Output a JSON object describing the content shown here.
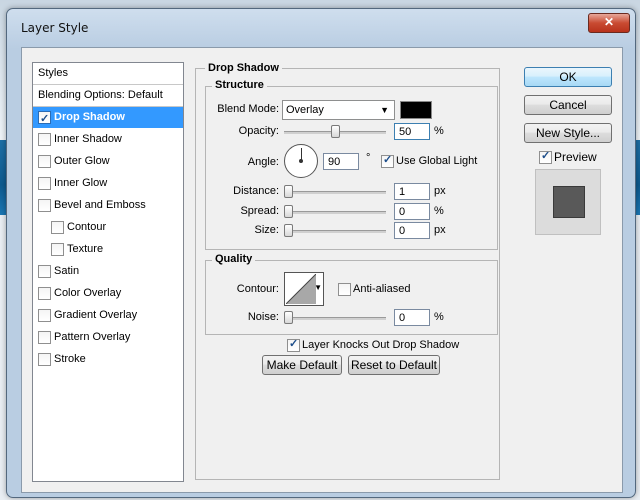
{
  "window": {
    "title": "Layer Style",
    "close_glyph": "✕"
  },
  "sidebar": {
    "header": "Styles",
    "blending_options": "Blending Options: Default",
    "items": [
      {
        "label": "Drop Shadow",
        "checked": true,
        "selected": true
      },
      {
        "label": "Inner Shadow",
        "checked": false
      },
      {
        "label": "Outer Glow",
        "checked": false
      },
      {
        "label": "Inner Glow",
        "checked": false
      },
      {
        "label": "Bevel and Emboss",
        "checked": false
      },
      {
        "label": "Contour",
        "checked": false,
        "indent": true
      },
      {
        "label": "Texture",
        "checked": false,
        "indent": true
      },
      {
        "label": "Satin",
        "checked": false
      },
      {
        "label": "Color Overlay",
        "checked": false
      },
      {
        "label": "Gradient Overlay",
        "checked": false
      },
      {
        "label": "Pattern Overlay",
        "checked": false
      },
      {
        "label": "Stroke",
        "checked": false
      }
    ]
  },
  "drop_shadow": {
    "title": "Drop Shadow",
    "structure": {
      "title": "Structure",
      "blend_mode_label": "Blend Mode:",
      "blend_mode_value": "Overlay",
      "shadow_color": "#000000",
      "opacity_label": "Opacity:",
      "opacity_value": "50",
      "opacity_unit": "%",
      "angle_label": "Angle:",
      "angle_value": "90",
      "angle_unit": "°",
      "use_global_light_label": "Use Global Light",
      "use_global_light_checked": true,
      "distance_label": "Distance:",
      "distance_value": "1",
      "distance_unit": "px",
      "spread_label": "Spread:",
      "spread_value": "0",
      "spread_unit": "%",
      "size_label": "Size:",
      "size_value": "0",
      "size_unit": "px"
    },
    "quality": {
      "title": "Quality",
      "contour_label": "Contour:",
      "anti_aliased_label": "Anti-aliased",
      "anti_aliased_checked": false,
      "noise_label": "Noise:",
      "noise_value": "0",
      "noise_unit": "%"
    },
    "layer_knocks_out_label": "Layer Knocks Out Drop Shadow",
    "layer_knocks_out_checked": true,
    "make_default_label": "Make Default",
    "reset_to_default_label": "Reset to Default"
  },
  "buttons": {
    "ok": "OK",
    "cancel": "Cancel",
    "new_style": "New Style..."
  },
  "preview": {
    "label": "Preview",
    "checked": true
  }
}
